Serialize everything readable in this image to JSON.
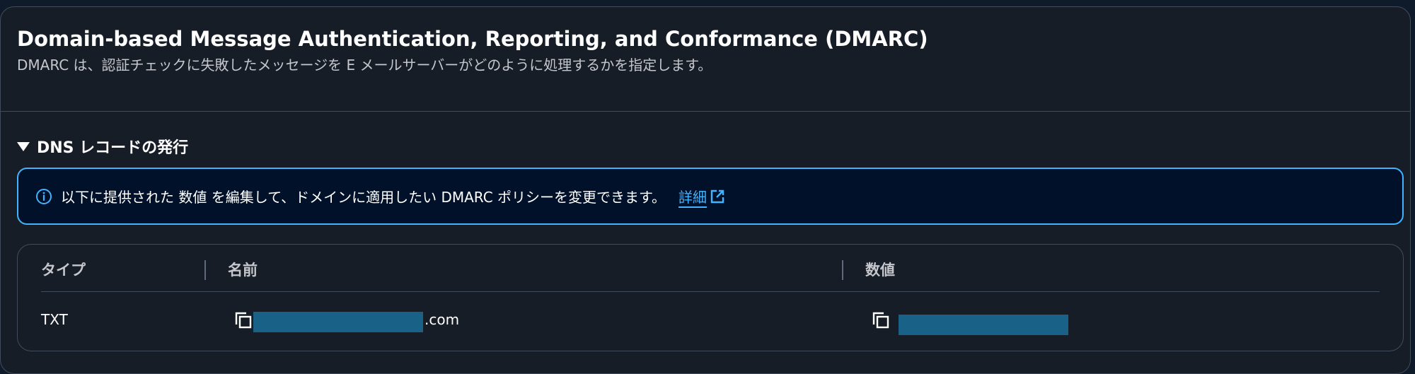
{
  "header": {
    "title": "Domain-based Message Authentication, Reporting, and Conformance (DMARC)",
    "description": "DMARC は、認証チェックに失敗したメッセージを E メールサーバーがどのように処理するかを指定します。"
  },
  "section": {
    "title": "DNS レコードの発行",
    "expanded": true
  },
  "alert": {
    "type": "info",
    "text": "以下に提供された 数値 を編集して、ドメインに適用したい DMARC ポリシーを変更できます。",
    "link_label": "詳細",
    "link_icon": "external-link-icon",
    "accent_color": "#42b4ff"
  },
  "table": {
    "columns": [
      "タイプ",
      "名前",
      "数値"
    ],
    "rows": [
      {
        "type": "TXT",
        "name_suffix": ".com",
        "name_redacted": true,
        "value_redacted": true
      }
    ]
  }
}
